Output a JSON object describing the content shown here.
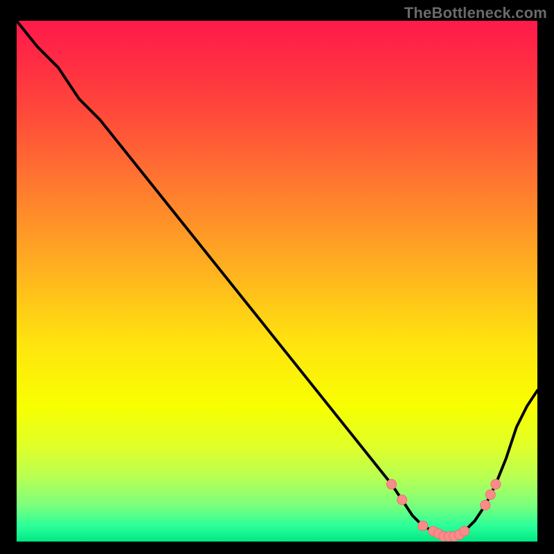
{
  "watermark": "TheBottleneck.com",
  "colors": {
    "curve": "#000000",
    "marker_fill": "#f98b8b",
    "marker_stroke": "#ef6f6f"
  },
  "chart_data": {
    "type": "line",
    "title": "",
    "xlabel": "",
    "ylabel": "",
    "xlim": [
      0,
      100
    ],
    "ylim": [
      0,
      100
    ],
    "x": [
      0,
      4,
      8,
      12,
      16,
      20,
      24,
      28,
      32,
      36,
      40,
      44,
      48,
      52,
      56,
      60,
      64,
      68,
      72,
      74,
      76,
      78,
      80,
      82,
      84,
      86,
      88,
      90,
      92,
      94,
      96,
      98,
      100
    ],
    "values": [
      100,
      95,
      91,
      85,
      81,
      76,
      71,
      66,
      61,
      56,
      51,
      46,
      41,
      36,
      31,
      26,
      21,
      16,
      11,
      8,
      5,
      3,
      2,
      1,
      1,
      2,
      4,
      7,
      11,
      16,
      22,
      26,
      29
    ],
    "markers_x": [
      72,
      74,
      78,
      80,
      81,
      82,
      83,
      84,
      85,
      86,
      90,
      91,
      92
    ],
    "markers_y": [
      11,
      8,
      3,
      2,
      1.5,
      1,
      1,
      1,
      1.3,
      2,
      7,
      9,
      11
    ]
  }
}
